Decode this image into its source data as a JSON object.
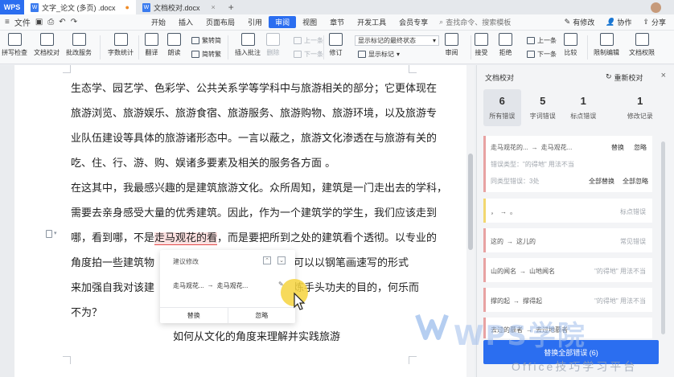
{
  "titlebar": {
    "logo": "WPS",
    "tabs": [
      {
        "label": "文字_论文 (多页) .docx",
        "active": true
      },
      {
        "label": "文档校对.docx",
        "active": false
      }
    ],
    "new_tab": "+"
  },
  "menubar": {
    "file": "文件",
    "items": [
      "开始",
      "插入",
      "页面布局",
      "引用",
      "审阅",
      "视图",
      "章节",
      "开发工具",
      "会员专享"
    ],
    "active": "审阅",
    "search_placeholder": "查找命令、搜索模板",
    "right": [
      "有修改",
      "协作",
      "分享"
    ]
  },
  "ribbon": {
    "spell_check": "拼写检查",
    "doc_proof": "文档校对",
    "comment_check": "批改服务",
    "word_count": "字数统计",
    "translate": "翻译",
    "read_aloud": "朗读",
    "trad_to_simp": "繁转简",
    "simp_to_trad": "简转繁",
    "insert_comment": "插入批注",
    "delete": "删除",
    "prev": "上一条",
    "next": "下一条",
    "track": "修订",
    "markup_select": "显示标记的最终状态",
    "show_markup": "显示标记",
    "review": "审阅",
    "accept": "接受",
    "reject": "拒绝",
    "prev2": "上一条",
    "next2": "下一条",
    "compare": "比较",
    "restrict": "限制编辑",
    "doc_perm": "文档权限"
  },
  "document": {
    "lines": [
      "生态学、园艺学、色彩学、公共关系学等学科中与旅游相关的部分；它更体现在",
      "旅游浏览、旅游娱乐、旅游食宿、旅游服务、旅游购物、旅游环境，以及旅游专",
      "业队伍建设等具体的旅游诸形态中。一言以蔽之，旅游文化渗透在与旅游有关的",
      "吃、住、行、游、购、娱诸多要素及相关的服务各方面 。",
      "在这其中，我最感兴趣的是建筑旅游文化。众所周知，建筑是一门走出去的学科，",
      "需要去亲身感受大量的优秀建筑。因此，作为一个建筑学的学生，我们应该走到"
    ],
    "line7_before": "哪，看到哪，不是",
    "line7_highlight": "走马观花的看",
    "line7_after": "，而是要把所到之处的建筑看个透彻。以专业的",
    "line8_start": "角度拍一些建筑物",
    "line8_end": "还可以以钢笔画速写的形式",
    "line9_start": "来加强自我对该建",
    "line9_end": "锻炼手头功夫的目的，何乐而",
    "line10": "不为？",
    "heading": "如何从文化的角度来理解并实践旅游"
  },
  "popup": {
    "title": "建议修改",
    "original": "走马观花...",
    "arrow": "→",
    "suggestion": "走马观花...",
    "replace": "替换",
    "ignore": "忽略"
  },
  "panel": {
    "title": "文档校对",
    "recheck": "重新校对",
    "stats": [
      {
        "num": "6",
        "label": "所有错误"
      },
      {
        "num": "5",
        "label": "字词错误"
      },
      {
        "num": "1",
        "label": "标点错误"
      },
      {
        "num": "1",
        "label": "修改记录"
      }
    ],
    "expanded": {
      "original": "走马观花的...",
      "suggestion": "走马观花...",
      "replace": "替换",
      "ignore": "忽略",
      "type_label": "错误类型：",
      "type_value": "\"的得地\" 用法不当",
      "same_label": "同类型错误：",
      "same_count": "3处",
      "replace_all": "全部替换",
      "ignore_all": "全部忽略"
    },
    "cards": [
      {
        "original": "，",
        "suggestion": "。",
        "type": "标点错误"
      },
      {
        "original": "这的",
        "suggestion": "这儿的",
        "type": "常见错误"
      },
      {
        "original": "山的闻名",
        "suggestion": "山地闻名",
        "type": "\"的得地\" 用法不当"
      },
      {
        "original": "撑的起",
        "suggestion": "撑得起",
        "type": "\"的得地\" 用法不当"
      },
      {
        "original": "去过的慕者",
        "suggestion": "去过地慕者",
        "type": ""
      }
    ],
    "replace_all_button": "替换全部错误 (6)"
  },
  "watermark": {
    "text": "WPS学院",
    "sub": "Office技巧学习平台"
  },
  "colors": {
    "accent": "#2b6ef0",
    "error_border": "#e8a2a2",
    "highlight": "#fbe0e0",
    "cursor_ring": "#f6d43e"
  }
}
